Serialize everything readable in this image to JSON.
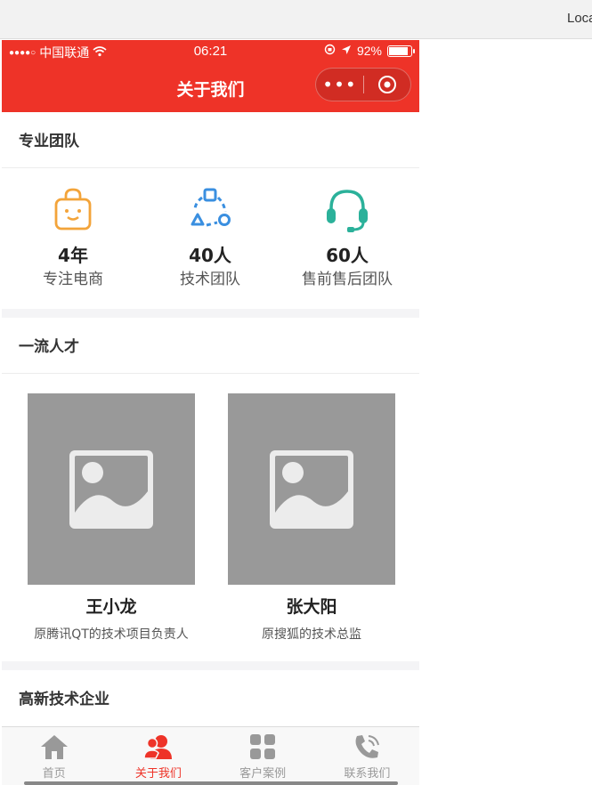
{
  "browser": {
    "url_text": "Loca"
  },
  "status_bar": {
    "carrier": "中国联通",
    "time": "06:21",
    "battery": "92%",
    "battery_level": 0.92
  },
  "nav": {
    "title": "关于我们",
    "more_icon": "more-dots-icon",
    "close_icon": "target-circle-icon"
  },
  "sections": {
    "team": {
      "title": "专业团队",
      "stats": [
        {
          "value": "4年",
          "label": "专注电商",
          "icon": "shopping-bag-icon",
          "color": "#f3a43a"
        },
        {
          "value": "40人",
          "label": "技术团队",
          "icon": "connection-icon",
          "color": "#3a8fe0"
        },
        {
          "value": "60人",
          "label": "售前售后团队",
          "icon": "headset-icon",
          "color": "#2bb19a"
        }
      ]
    },
    "talent": {
      "title": "一流人才",
      "people": [
        {
          "name": "王小龙",
          "desc": "原腾讯QT的技术项目负责人"
        },
        {
          "name": "张大阳",
          "desc": "原搜狐的技术总监"
        }
      ]
    },
    "hightech": {
      "title": "高新技术企业"
    }
  },
  "tabbar": {
    "items": [
      {
        "label": "首页",
        "icon": "home-icon",
        "active": false
      },
      {
        "label": "关于我们",
        "icon": "users-icon",
        "active": true
      },
      {
        "label": "客户案例",
        "icon": "grid-icon",
        "active": false
      },
      {
        "label": "联系我们",
        "icon": "phone-icon",
        "active": false
      }
    ]
  },
  "colors": {
    "brand": "#ee3328",
    "inactive": "#999999",
    "photo_placeholder": "#999999"
  }
}
